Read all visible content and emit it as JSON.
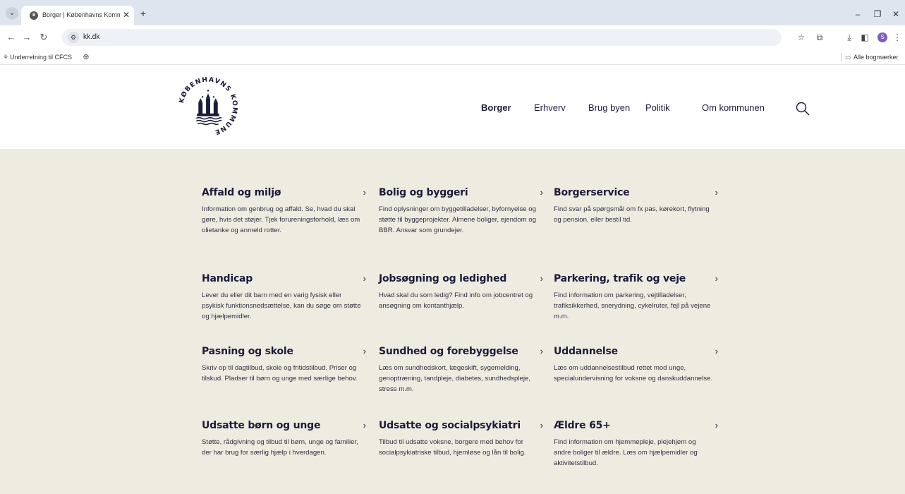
{
  "browser": {
    "tab_title": "Borger | Københavns Kommune",
    "url": "kk.dk",
    "bookmarks": {
      "item1": "Underretning til CFCS",
      "all_bookmarks": "Alle bogmærker"
    }
  },
  "header": {
    "logo_text": "KØBENHAVNS KOMMUNE",
    "nav": [
      "Borger",
      "Erhverv",
      "Brug byen",
      "Politik",
      "Om kommunen"
    ],
    "active_nav": "Borger"
  },
  "cards": [
    {
      "title": "Affald og miljø",
      "desc": "Information om genbrug og affald. Se, hvad du skal gøre, hvis det støjer. Tjek forureningsforhold, læs om olietanke og anmeld rotter."
    },
    {
      "title": "Bolig og byggeri",
      "desc": "Find oplysninger om byggetilladelser, byfornyelse og støtte til byggeprojekter. Almene boliger, ejendom og BBR. Ansvar som grundejer."
    },
    {
      "title": "Borgerservice",
      "desc": "Find svar på spørgsmål om fx pas, kørekort, flytning og pension, eller bestil tid."
    },
    {
      "title": "Handicap",
      "desc": "Lever du eller dit barn med en varig fysisk eller psykisk funktionsnedsættelse, kan du søge om støtte og hjælpemidler."
    },
    {
      "title": "Jobsøgning og ledighed",
      "desc": "Hvad skal du som ledig? Find info om jobcentret og ansøgning om kontanthjælp."
    },
    {
      "title": "Parkering, trafik og veje",
      "desc": "Find information om parkering, vejtilladelser, trafiksikkerhed, snerydning, cykelruter, fejl på vejene m.m."
    },
    {
      "title": "Pasning og skole",
      "desc": "Skriv op til dagtilbud, skole og fritidstilbud. Priser og tilskud. Pladser til børn og unge med særlige behov."
    },
    {
      "title": "Sundhed og forebyggelse",
      "desc": "Læs om sundhedskort, lægeskift, sygemelding, genoptræning, tandpleje, diabetes, sundhedspleje, stress m.m."
    },
    {
      "title": "Uddannelse",
      "desc": "Læs om uddannelsestilbud rettet mod unge, specialundervisning for voksne og danskuddannelse."
    },
    {
      "title": "Udsatte børn og unge",
      "desc": "Støtte, rådgivning og tilbud til børn, unge og familier, der har brug for særlig hjælp i hverdagen."
    },
    {
      "title": "Udsatte og socialpsykiatri",
      "desc": "Tilbud til udsatte voksne, borgere med behov for socialpsykiatriske tilbud, hjemløse og lån til bolig."
    },
    {
      "title": "Ældre 65+",
      "desc": "Find information om hjemmepleje, plejehjem og andre boliger til ældre. Læs om hjælpemidler og aktivitetstilbud."
    }
  ],
  "icons": {
    "chevron": "›",
    "search": "search-icon",
    "brand_color": "#1b1b3a",
    "content_bg": "#eeece1"
  }
}
